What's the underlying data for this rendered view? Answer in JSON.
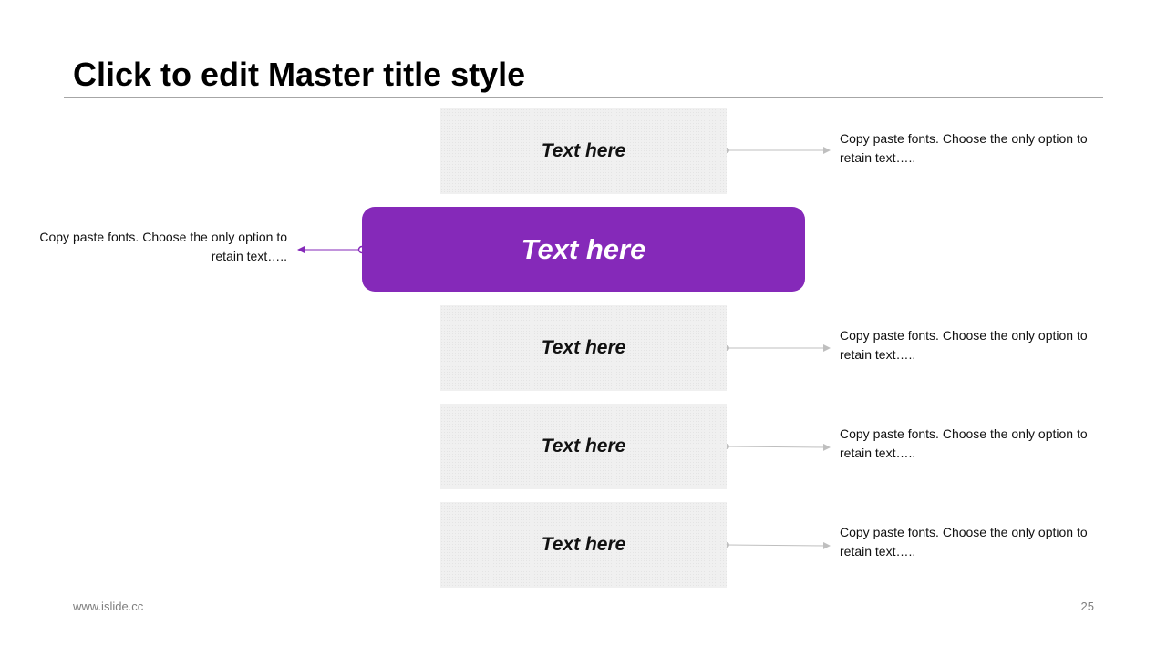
{
  "slide": {
    "title": "Click to edit Master title style",
    "items": [
      {
        "label": "Text here",
        "description": "Copy paste fonts. Choose the only option to retain text….."
      },
      {
        "label": "Text here",
        "description": "Copy paste fonts. Choose the only option to retain text….."
      },
      {
        "label": "Text here",
        "description": "Copy paste fonts. Choose the only option to retain text….."
      },
      {
        "label": "Text here",
        "description": "Copy paste fonts. Choose the only option to retain text….."
      },
      {
        "label": "Text here",
        "description": "Copy paste fonts. Choose the only option to retain text….."
      }
    ],
    "highlighted_index": 1,
    "footer_url": "www.islide.cc",
    "page_number": "25"
  },
  "colors": {
    "accent": "#8529b9",
    "box_fill": "#f0f0f0",
    "connector_gray": "#bfbfbf",
    "rule_gray": "#a6a6a6",
    "footer_gray": "#7f7f7f"
  }
}
